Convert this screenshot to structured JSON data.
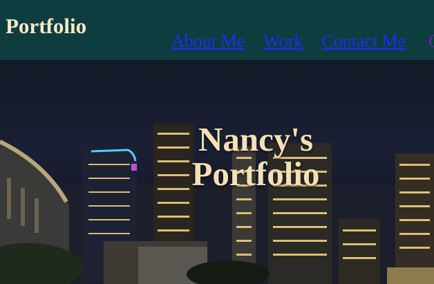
{
  "header": {
    "brand": "Portfolio",
    "nav": [
      {
        "label": "About Me"
      },
      {
        "label": "Work"
      },
      {
        "label": "Contact Me"
      }
    ],
    "nav_overflow_glyph": "C"
  },
  "hero": {
    "title_line1": "Nancy's",
    "title_line2": "Portfolio"
  },
  "colors": {
    "header_bg": "#0e3d40",
    "brand_text": "#f7e9c4",
    "link": "#1f2cff",
    "hero_text": "#f5dfb4"
  }
}
